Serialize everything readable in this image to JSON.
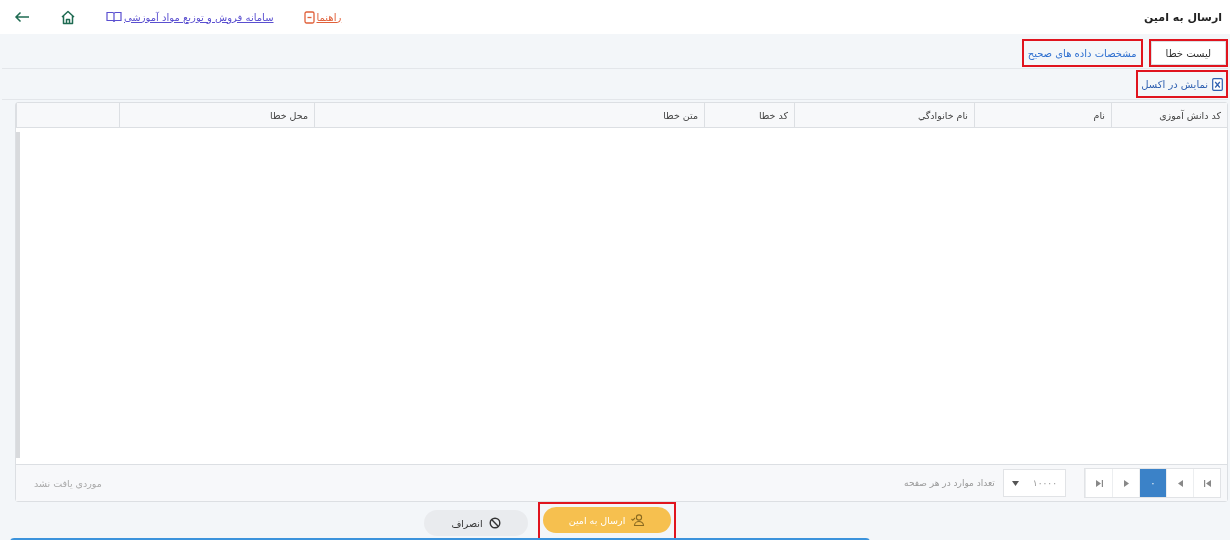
{
  "header": {
    "title": "ارسال به امین",
    "links": [
      {
        "kind": "help",
        "label": "راهنما"
      },
      {
        "kind": "system",
        "label": "سامانه فروش و توزیع مواد آموزشی"
      }
    ]
  },
  "tabs": [
    {
      "label": "لیست خطا",
      "selected": true,
      "highlighted": true
    },
    {
      "label": "مشخصات داده های صحیح",
      "selected": false,
      "highlighted": true
    }
  ],
  "toolbar": {
    "excel_button": {
      "label": "نمایش در اکسل",
      "highlighted": true
    }
  },
  "table": {
    "columns": [
      "کد دانش آموزی",
      "نام",
      "نام خانوادگي",
      "کد خطا",
      "متن خطا",
      "محل خطا",
      ""
    ],
    "pager": {
      "pages": [
        {
          "label": "۰",
          "selected": true
        }
      ],
      "page_size": "۱۰۰۰۰",
      "page_size_label": "تعداد موارد در هر صفحه",
      "status": "موردی یافت نشد"
    }
  },
  "actions": [
    {
      "kind": "primary",
      "label": "ارسال به امین",
      "highlighted": true
    },
    {
      "kind": "cancel",
      "label": "انصراف",
      "highlighted": false
    }
  ]
}
